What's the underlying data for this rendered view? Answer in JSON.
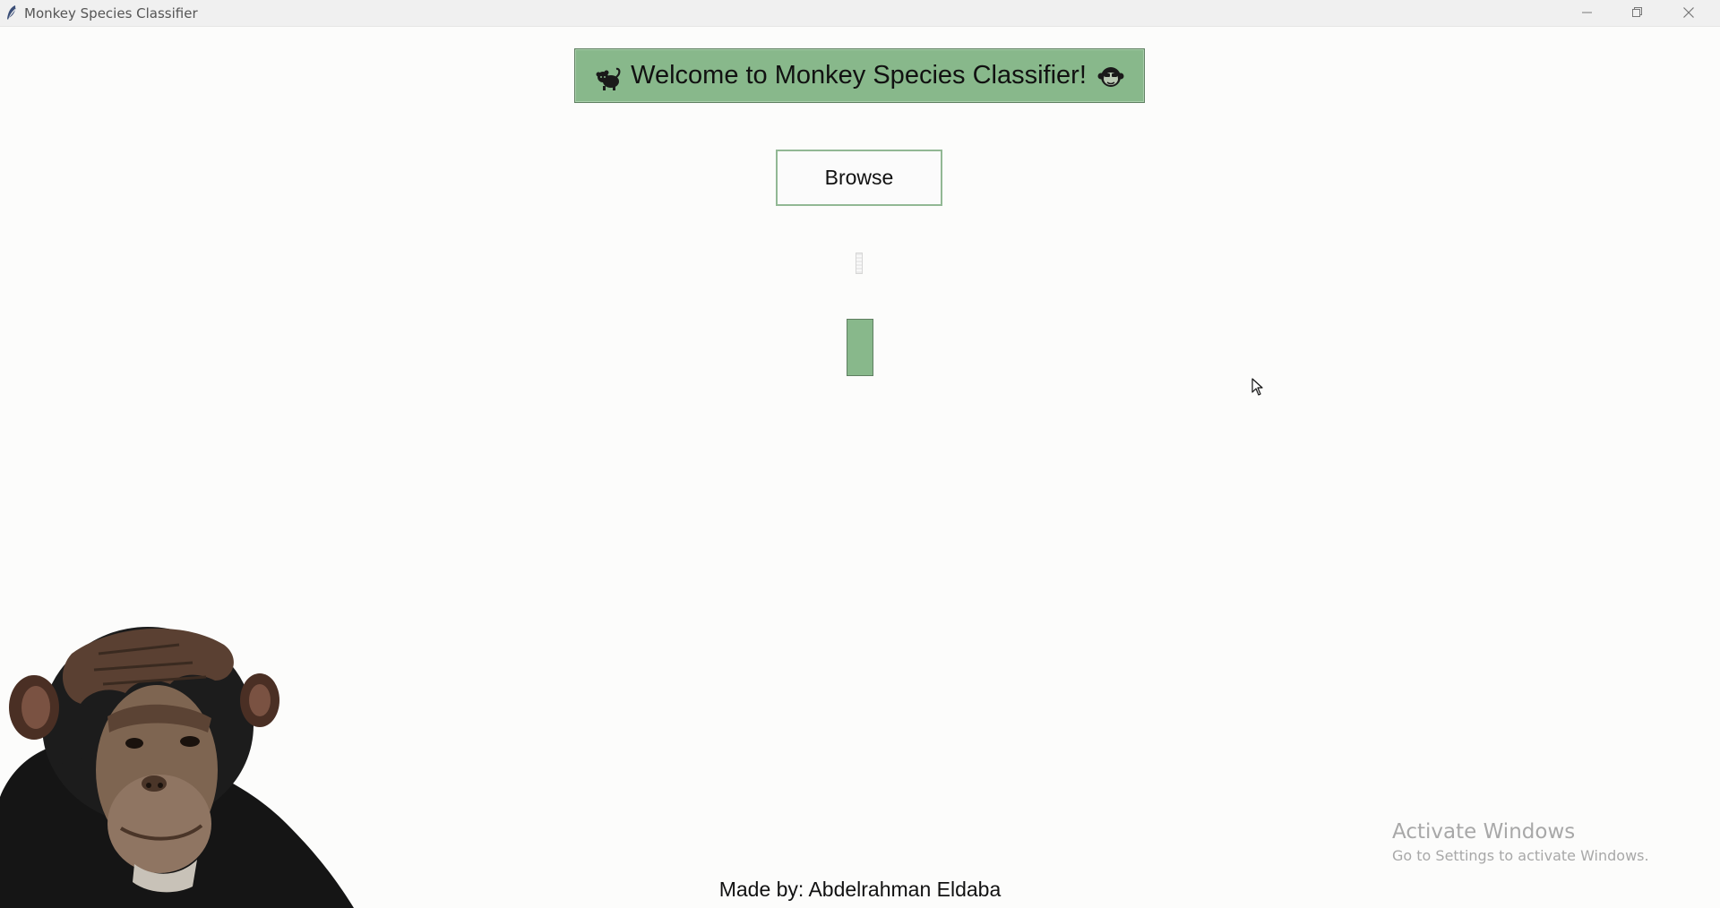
{
  "window": {
    "title": "Monkey Species Classifier",
    "icon": "feather-icon",
    "controls": [
      "minimize-icon",
      "restore-icon",
      "close-icon"
    ]
  },
  "banner": {
    "text": "Welcome to Monkey Species Classifier!",
    "left_icon": "monkey-icon",
    "right_icon": "monkey-face-icon",
    "background": "#88b88b"
  },
  "browse_button": {
    "label": "Browse"
  },
  "result": {
    "text": ""
  },
  "footer": {
    "credit": "Made by: Abdelrahman Eldaba"
  },
  "watermark": {
    "title": "Activate Windows",
    "subtitle": "Go to Settings to activate Windows."
  },
  "colors": {
    "accent_green": "#88b88b",
    "background": "#fcfcfb"
  }
}
